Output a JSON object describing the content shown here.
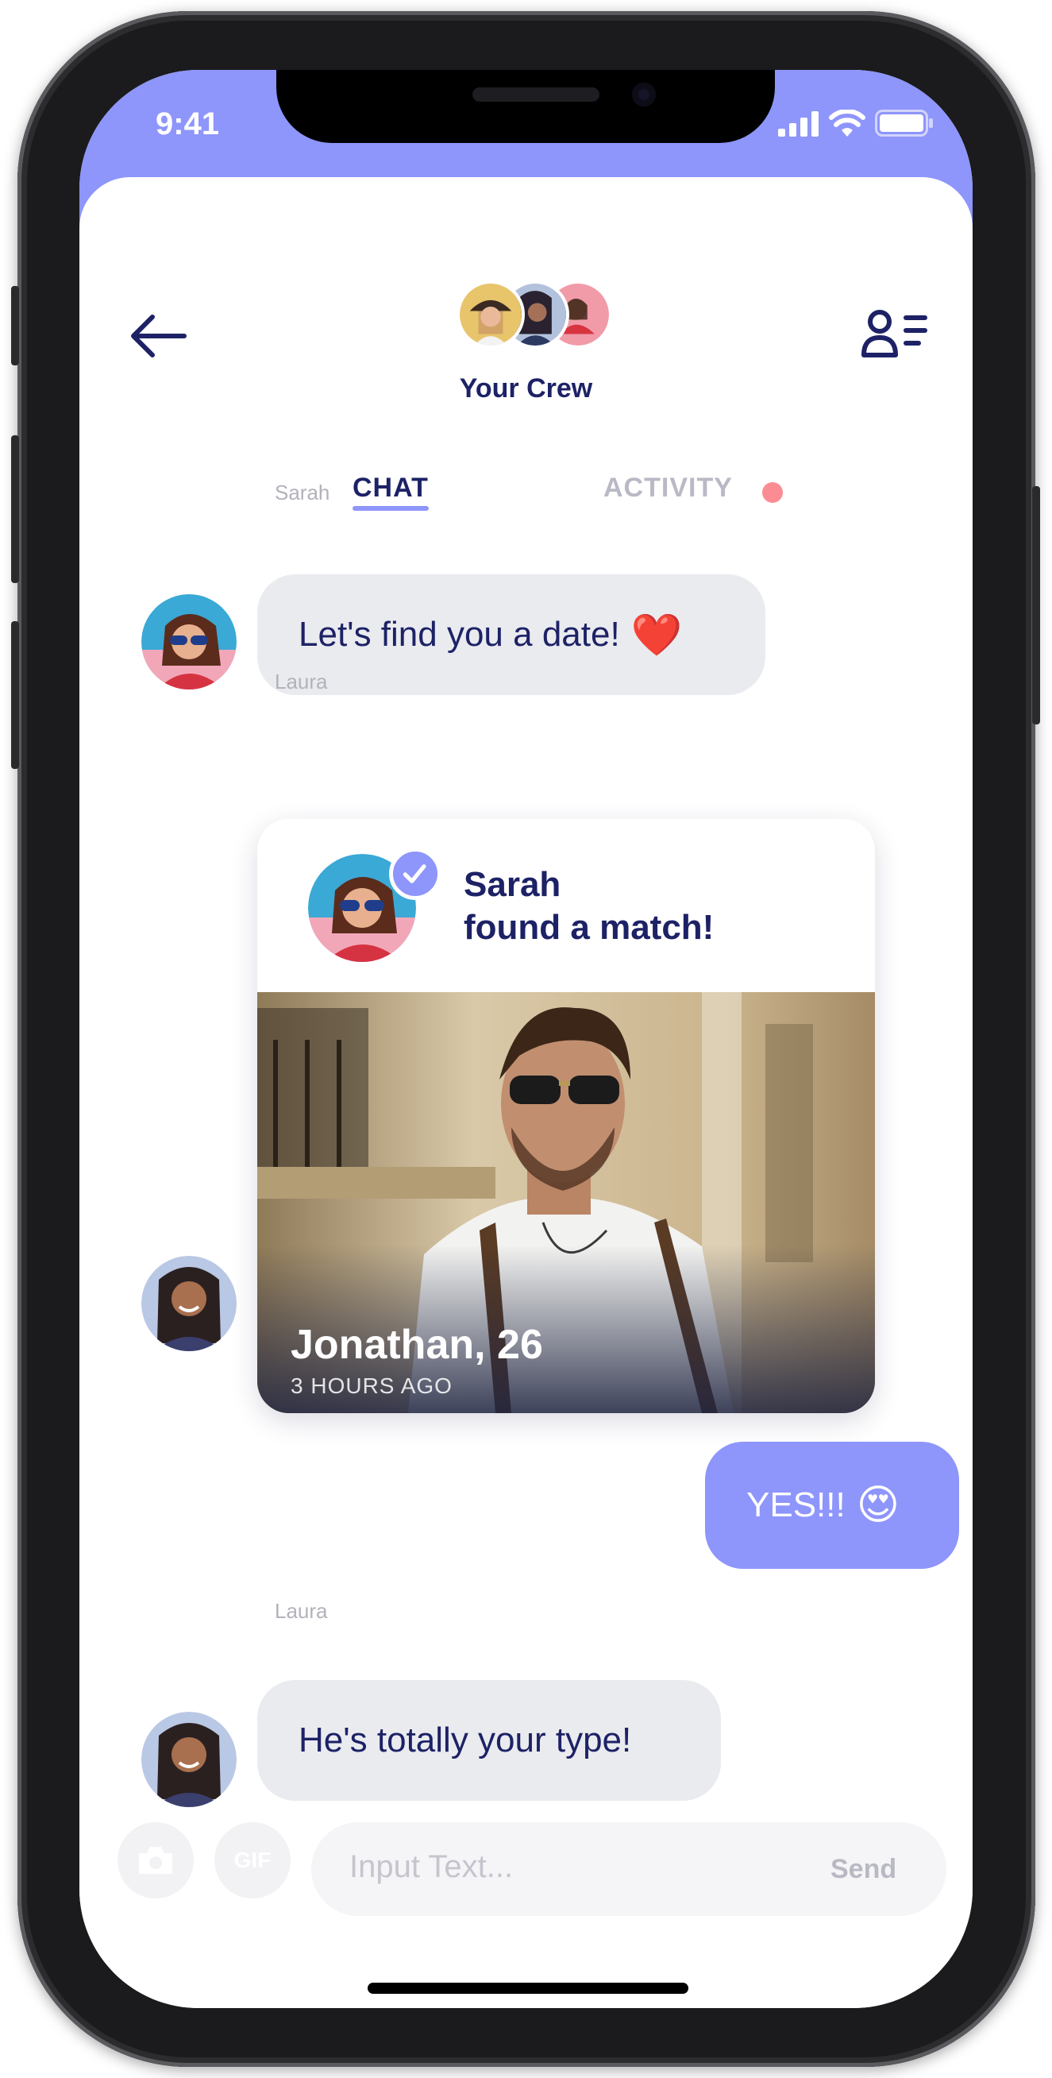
{
  "status_bar": {
    "time": "9:41"
  },
  "header": {
    "title": "Your Crew"
  },
  "tabs": [
    {
      "label": "CHAT",
      "active": true
    },
    {
      "label": "ACTIVITY",
      "active": false,
      "has_notification": true
    }
  ],
  "messages": [
    {
      "sender": "Sarah",
      "text": "Let's find you a date!",
      "emoji": "❤️"
    },
    {
      "sender": "Laura",
      "type": "match_card",
      "card": {
        "title_line1": "Sarah",
        "title_line2": "found a match!",
        "match_name": "Jonathan, 26",
        "match_time": "3 HOURS AGO"
      }
    },
    {
      "sender": "me",
      "text": "YES!!!",
      "emoji": "😍"
    },
    {
      "sender": "Laura",
      "text": "He's totally your type!"
    }
  ],
  "composer": {
    "gif_label": "GIF",
    "placeholder": "Input Text...",
    "send_label": "Send"
  },
  "colors": {
    "accent": "#8e95fb",
    "navy": "#1d2266",
    "bubble": "#eaebef",
    "notification": "#fc8c93"
  }
}
